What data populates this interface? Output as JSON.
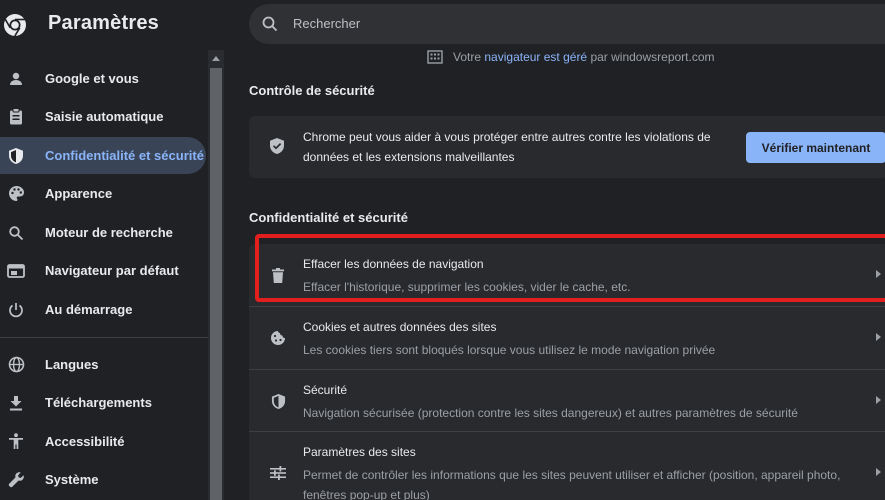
{
  "header": {
    "title": "Paramètres",
    "logo_icon": "chrome-logo-icon"
  },
  "search": {
    "placeholder": "Rechercher"
  },
  "sidebar": {
    "items": [
      {
        "label": "Google et vous",
        "icon": "person-icon",
        "active": false
      },
      {
        "label": "Saisie automatique",
        "icon": "clipboard-icon",
        "active": false
      },
      {
        "label": "Confidentialité et sécurité",
        "icon": "shield-icon",
        "active": true
      },
      {
        "label": "Apparence",
        "icon": "palette-icon",
        "active": false
      },
      {
        "label": "Moteur de recherche",
        "icon": "search-icon",
        "active": false
      },
      {
        "label": "Navigateur par défaut",
        "icon": "browser-icon",
        "active": false
      },
      {
        "label": "Au démarrage",
        "icon": "power-icon",
        "active": false
      },
      {
        "label": "Langues",
        "icon": "globe-icon",
        "active": false
      },
      {
        "label": "Téléchargements",
        "icon": "download-icon",
        "active": false
      },
      {
        "label": "Accessibilité",
        "icon": "accessibility-icon",
        "active": false
      },
      {
        "label": "Système",
        "icon": "wrench-icon",
        "active": false
      }
    ]
  },
  "managed": {
    "prefix": "Votre",
    "link": "navigateur est géré",
    "suffix": "par windowsreport.com"
  },
  "safety_check": {
    "section_title": "Contrôle de sécurité",
    "text": "Chrome peut vous aider à vous protéger entre autres contre les violations de données et les extensions malveillantes",
    "button_label": "Vérifier maintenant"
  },
  "privacy": {
    "section_title": "Confidentialité et sécurité",
    "rows": [
      {
        "title": "Effacer les données de navigation",
        "subtitle": "Effacer l'historique, supprimer les cookies, vider le cache, etc.",
        "icon": "trash-icon",
        "highlighted": true
      },
      {
        "title": "Cookies et autres données des sites",
        "subtitle": "Les cookies tiers sont bloqués lorsque vous utilisez le mode navigation privée",
        "icon": "cookie-icon"
      },
      {
        "title": "Sécurité",
        "subtitle": "Navigation sécurisée (protection contre les sites dangereux) et autres paramètres de sécurité",
        "icon": "shield-icon"
      },
      {
        "title": "Paramètres des sites",
        "subtitle": "Permet de contrôler les informations que les sites peuvent utiliser et afficher (position, appareil photo, fenêtres pop-up et plus)",
        "icon": "sliders-icon"
      }
    ]
  },
  "colors": {
    "accent": "#8ab4f8",
    "highlight_border": "#e21f1f",
    "background": "#202124"
  }
}
